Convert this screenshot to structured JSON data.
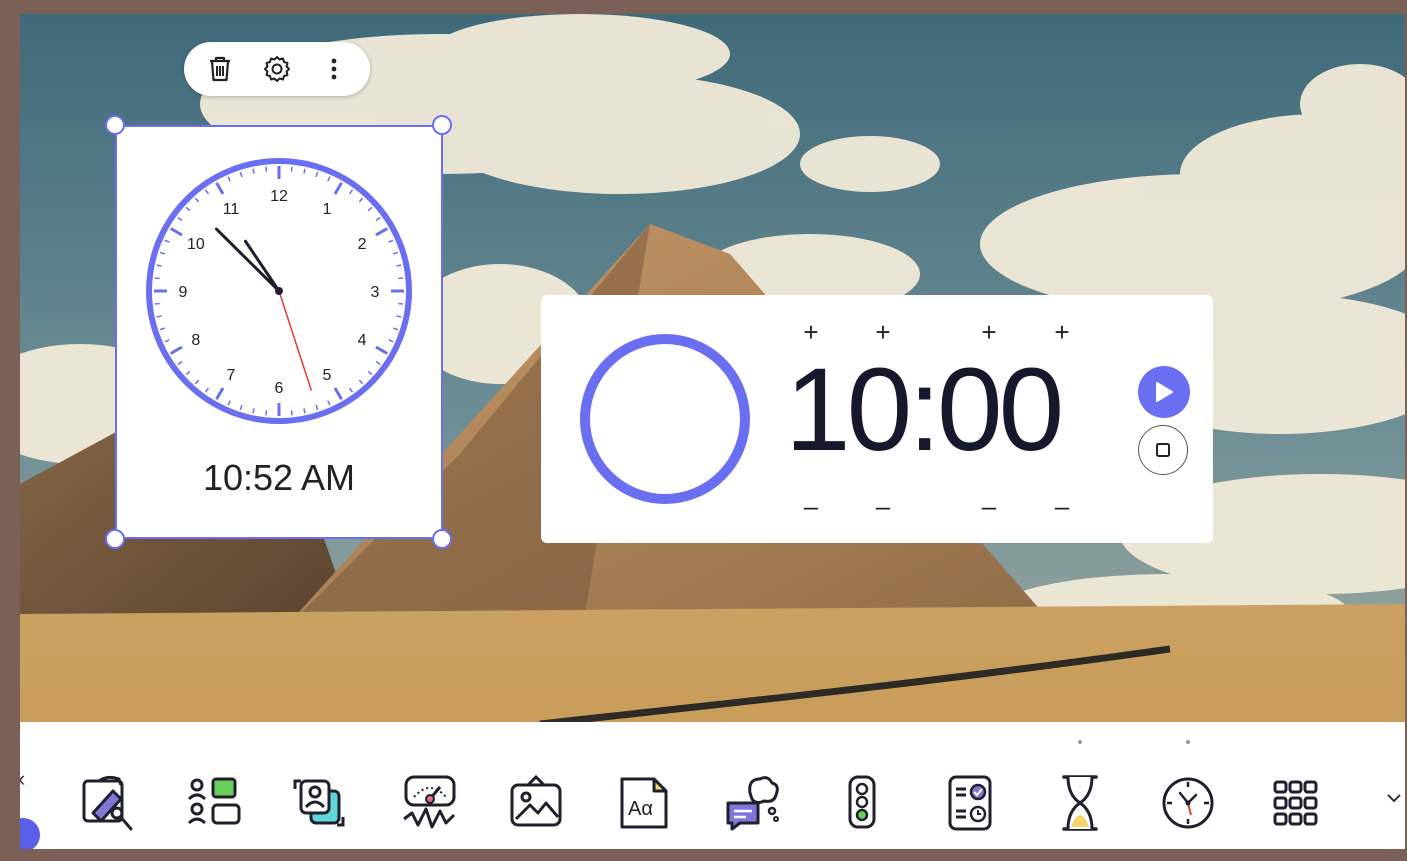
{
  "widget_toolbar": {
    "delete_icon": "trash-icon",
    "settings_icon": "gear-icon",
    "more_icon": "more-vertical-icon"
  },
  "clock": {
    "digital_time": "10:52 AM",
    "numerals": [
      "12",
      "1",
      "2",
      "3",
      "4",
      "5",
      "6",
      "7",
      "8",
      "9",
      "10",
      "11"
    ],
    "hour": 10,
    "minute": 52,
    "second": 27,
    "accent": "#6a6ef0",
    "second_hand_color": "#e53935"
  },
  "timer": {
    "time": "10:00",
    "plus_label": "+",
    "minus_label": "–",
    "play_icon": "play-icon",
    "stop_icon": "stop-icon",
    "accent": "#6a6ef0"
  },
  "dock": {
    "items": [
      {
        "icon": "drawing-tool-icon"
      },
      {
        "icon": "group-maker-icon"
      },
      {
        "icon": "random-name-picker-icon"
      },
      {
        "icon": "sound-level-meter-icon"
      },
      {
        "icon": "image-icon"
      },
      {
        "icon": "text-icon",
        "label": "Aα"
      },
      {
        "icon": "thought-chat-icon"
      },
      {
        "icon": "traffic-light-icon"
      },
      {
        "icon": "schedule-icon"
      },
      {
        "icon": "hourglass-timer-icon"
      },
      {
        "icon": "clock-icon"
      },
      {
        "icon": "app-grid-icon"
      }
    ],
    "expand_icon": "chevron-down-icon"
  }
}
